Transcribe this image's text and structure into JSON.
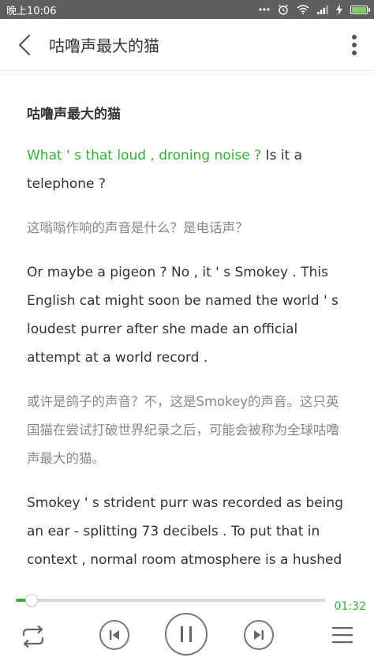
{
  "status_bar": {
    "time": "晚上10:06",
    "icons": [
      "dots-icon",
      "alarm-icon",
      "wifi-icon",
      "signal-icon",
      "charging-icon",
      "battery-icon"
    ]
  },
  "app_bar": {
    "title": "咕噜声最大的猫"
  },
  "article": {
    "title": "咕噜声最大的猫",
    "paragraphs": [
      {
        "lang": "en",
        "highlight": "What ' s that loud , droning noise ?",
        "text": " Is it a telephone ?"
      },
      {
        "lang": "zh",
        "text": "这嗡嗡作响的声音是什么？是电话声？"
      },
      {
        "lang": "en",
        "text": "Or maybe a pigeon ? No , it ' s Smokey . This English cat might soon be named the world ' s loudest purrer after she made an official attempt at a world record ."
      },
      {
        "lang": "zh",
        "text": "或许是鸽子的声音？不，这是Smokey的声音。这只英国猫在尝试打破世界纪录之后，可能会被称为全球咕噜声最大的猫。"
      },
      {
        "lang": "en",
        "text": "Smokey ' s strident purr was recorded as being an ear - splitting 73 decibels . To put that in context , normal room atmosphere is a hushed"
      }
    ]
  },
  "player": {
    "duration": "01:32",
    "progress_fraction": 0.05,
    "accent_color": "#33b233"
  }
}
